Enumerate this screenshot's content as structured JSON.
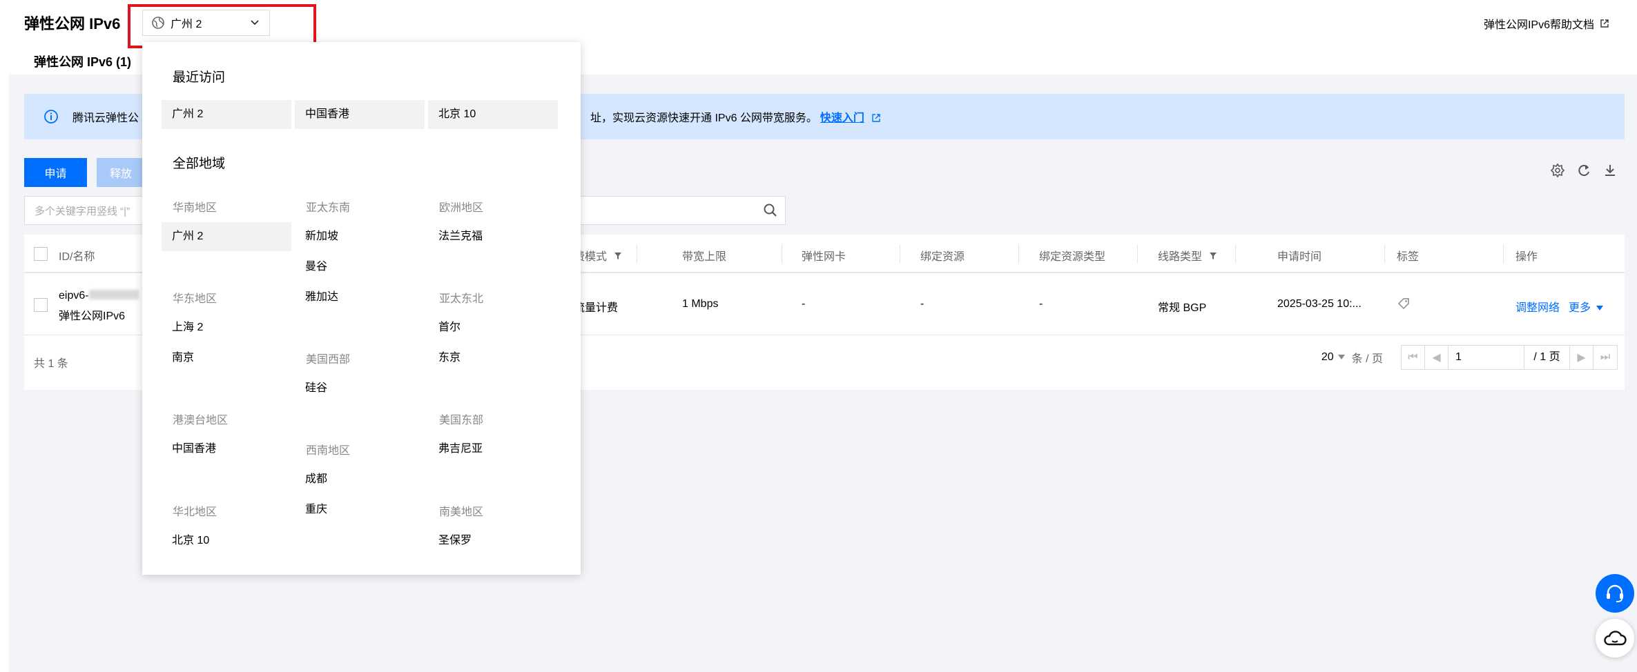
{
  "header": {
    "title": "弹性公网 IPv6",
    "region_selected": "广州 2",
    "help_link": "弹性公网IPv6帮助文档"
  },
  "tabs": [
    {
      "label": "弹性公网 IPv6 (1)"
    }
  ],
  "notice": {
    "left_text": "腾讯云弹性公",
    "right_text": "址，实现云资源快速开通 IPv6 公网带宽服务。",
    "quick_link": "快速入门"
  },
  "toolbar": {
    "apply": "申请",
    "release": "释放",
    "search_placeholder": "多个关键字用竖线 “|”"
  },
  "table": {
    "columns": {
      "id_name": "ID/名称",
      "billing": "费模式",
      "bandwidth": "带宽上限",
      "eni": "弹性网卡",
      "bound_resource": "绑定资源",
      "bound_type": "绑定资源类型",
      "line_type": "线路类型",
      "apply_time": "申请时间",
      "tags": "标签",
      "ops": "操作"
    },
    "row": {
      "id": "eipv6-",
      "name": "弹性公网IPv6",
      "billing": "流量计费",
      "bandwidth": "1 Mbps",
      "eni": "-",
      "bound_resource": "-",
      "bound_type": "-",
      "line_type": "常规 BGP",
      "apply_time": "2025-03-25 10:...",
      "op_adjust": "调整网络",
      "op_more": "更多"
    },
    "total": "共 1 条",
    "page_size": "20",
    "per_page": "条 / 页",
    "current_page": "1",
    "total_pages": "/ 1 页"
  },
  "dropdown": {
    "recent_title": "最近访问",
    "recent": [
      "广州 2",
      "中国香港",
      "北京 10"
    ],
    "all_title": "全部地域",
    "groups": {
      "south_china": {
        "label": "华南地区",
        "items": [
          "广州 2"
        ]
      },
      "east_china": {
        "label": "华东地区",
        "items": [
          "上海 2",
          "南京"
        ]
      },
      "hmt": {
        "label": "港澳台地区",
        "items": [
          "中国香港"
        ]
      },
      "north_china": {
        "label": "华北地区",
        "items": [
          "北京 10"
        ]
      },
      "ap_southeast": {
        "label": "亚太东南",
        "items": [
          "新加坡",
          "曼谷",
          "雅加达"
        ]
      },
      "us_west": {
        "label": "美国西部",
        "items": [
          "硅谷"
        ]
      },
      "southwest": {
        "label": "西南地区",
        "items": [
          "成都",
          "重庆"
        ]
      },
      "europe": {
        "label": "欧洲地区",
        "items": [
          "法兰克福"
        ]
      },
      "ap_northeast": {
        "label": "亚太东北",
        "items": [
          "首尔",
          "东京"
        ]
      },
      "us_east": {
        "label": "美国东部",
        "items": [
          "弗吉尼亚"
        ]
      },
      "south_america": {
        "label": "南美地区",
        "items": [
          "圣保罗"
        ]
      }
    }
  },
  "colors": {
    "accent": "#006eff",
    "highlight": "#e0141e",
    "notice_bg": "#d5e7ff",
    "page_bg": "#f3f4f7"
  }
}
